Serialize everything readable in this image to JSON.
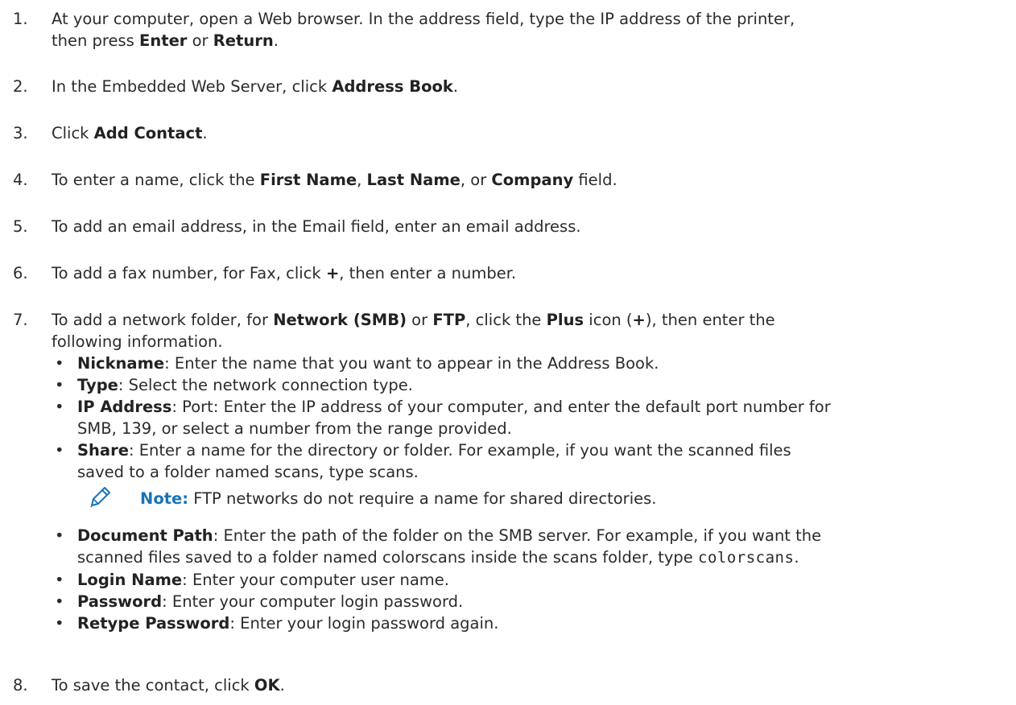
{
  "steps": [
    {
      "num": "1.",
      "parts": [
        "At your computer, open a Web browser. In the address field, type the IP address of the printer,",
        "then press ",
        "Enter",
        " or ",
        "Return",
        "."
      ]
    },
    {
      "num": "2.",
      "parts": [
        "In the Embedded Web Server, click ",
        "Address Book",
        "."
      ]
    },
    {
      "num": "3.",
      "parts": [
        "Click ",
        "Add Contact",
        "."
      ]
    },
    {
      "num": "4.",
      "parts": [
        "To enter a name, click the ",
        "First Name",
        ", ",
        "Last Name",
        ", or ",
        "Company",
        " field."
      ]
    },
    {
      "num": "5.",
      "parts": [
        "To add an email address, in the Email field, enter an email address."
      ]
    },
    {
      "num": "6.",
      "parts": [
        "To add a fax number, for Fax, click ",
        "+",
        ", then enter a number."
      ]
    },
    {
      "num": "7.",
      "parts": [
        "To add a network folder, for ",
        "Network (SMB)",
        " or ",
        "FTP",
        ", click the ",
        "Plus",
        " icon (",
        "+",
        "), then enter the",
        "following information."
      ]
    },
    {
      "num": "8.",
      "parts": [
        "To save the contact, click ",
        "OK",
        "."
      ]
    }
  ],
  "bullets_a": [
    {
      "term": "Nickname",
      "desc": ": Enter the name that you want to appear in the Address Book."
    },
    {
      "term": "Type",
      "desc": ": Select the network connection type."
    },
    {
      "term": "IP Address",
      "desc": ": Port: Enter the IP address of your computer, and enter the default port number for",
      "desc2": "SMB, 139, or select a number from the range provided."
    },
    {
      "term": "Share",
      "desc": ": Enter a name for the directory or folder. For example, if you want the scanned files",
      "desc2": "saved to a folder named scans, type scans."
    }
  ],
  "note": {
    "label": "Note:",
    "text": " FTP networks do not require a name for shared directories.",
    "icon": "pencil-icon",
    "accent": "#1a73b8"
  },
  "bullets_b": [
    {
      "term": "Document Path",
      "desc": ": Enter the path of the folder on the SMB server. For example, if you want the",
      "desc2": "scanned files saved to a folder named colorscans inside the scans folder, type ",
      "code": "colorscans",
      "tail": "."
    },
    {
      "term": "Login Name",
      "desc": ": Enter your computer user name."
    },
    {
      "term": "Password",
      "desc": ": Enter your computer login password."
    },
    {
      "term": "Retype Password",
      "desc": ": Enter your login password again."
    }
  ],
  "bullet_glyph": "•"
}
